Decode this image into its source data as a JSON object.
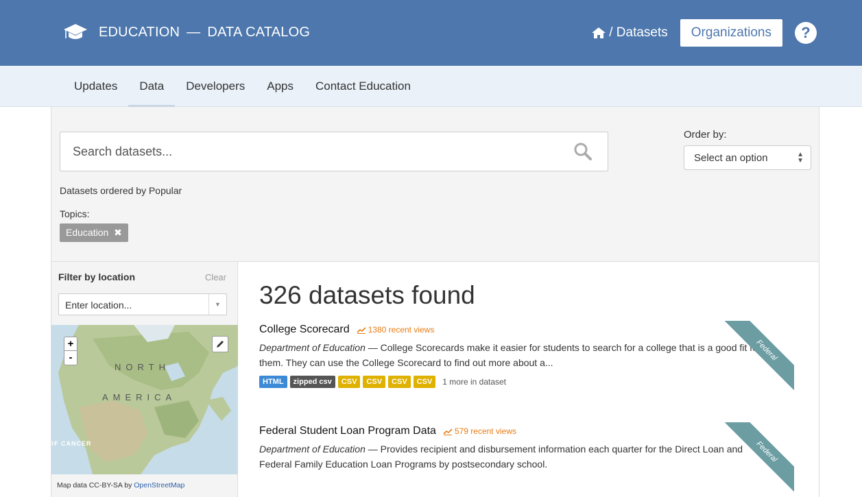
{
  "header": {
    "title": "EDUCATION",
    "separator": "—",
    "subtitle": "DATA CATALOG",
    "breadcrumb": "/ Datasets",
    "organizations_label": "Organizations",
    "help_label": "?"
  },
  "subnav": {
    "items": [
      {
        "label": "Updates"
      },
      {
        "label": "Data"
      },
      {
        "label": "Developers"
      },
      {
        "label": "Apps"
      },
      {
        "label": "Contact Education"
      }
    ],
    "active": "Data"
  },
  "search": {
    "placeholder": "Search datasets...",
    "order_label": "Order by:",
    "order_value": "Select an option",
    "ordered_by_text": "Datasets ordered by Popular",
    "topics_label": "Topics:",
    "topic_tag": "Education",
    "topic_tag_remove": "✖"
  },
  "sidebar": {
    "filter_title": "Filter by location",
    "clear_label": "Clear",
    "location_placeholder": "Enter location...",
    "zoom_in": "+",
    "zoom_out": "-",
    "map_label_north": "NORTH",
    "map_label_america": "AMERICA",
    "map_label_cancer": "OF CANCER",
    "attribution_prefix": "Map data CC-BY-SA by ",
    "attribution_link": "OpenStreetMap"
  },
  "results": {
    "count_text": "326 datasets found",
    "datasets": [
      {
        "title": "College Scorecard",
        "views": "1380 recent views",
        "publisher": "Department of Education",
        "dash": " — ",
        "description": "College Scorecards make it easier for students to search for a college that is a good fit for them. They can use the College Scorecard to find out more about a...",
        "formats": [
          "HTML",
          "zipped csv",
          "CSV",
          "CSV",
          "CSV",
          "CSV"
        ],
        "more": "1 more in dataset",
        "ribbon": "Federal"
      },
      {
        "title": "Federal Student Loan Program Data",
        "views": "579 recent views",
        "publisher": "Department of Education",
        "dash": " — ",
        "description": "Provides recipient and disbursement information each quarter for the Direct Loan and Federal Family Education Loan Programs by postsecondary school.",
        "ribbon": "Federal"
      }
    ]
  },
  "colors": {
    "header_bg": "#4d77ad",
    "subnav_bg": "#eaf1f9",
    "views_orange": "#e87b14",
    "html_badge": "#3c8ad6",
    "zip_badge": "#555555",
    "csv_badge": "#dfb100",
    "ribbon": "#6b9da3"
  }
}
